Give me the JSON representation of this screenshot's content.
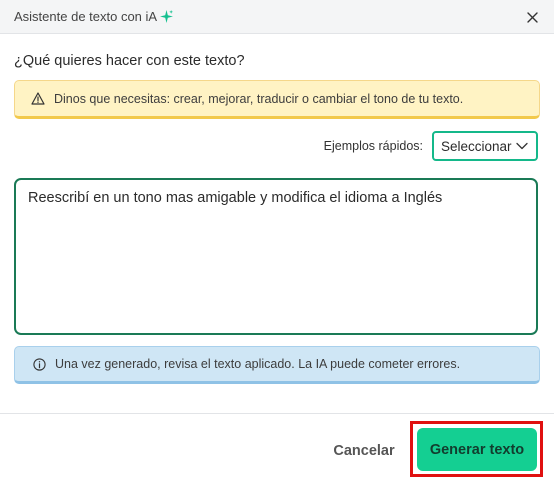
{
  "header": {
    "title": "Asistente de texto con iA",
    "accent_color": "#14c08f"
  },
  "question": "¿Qué quieres hacer con este texto?",
  "warning": {
    "text": "Dinos que necesitas: crear, mejorar, traducir o cambiar el tono de tu texto.",
    "color": "#f2c94c"
  },
  "quick_examples": {
    "label": "Ejemplos rápidos:",
    "selected": "Seleccionar"
  },
  "prompt": {
    "value": "Reescribí en un tono mas amigable y modifica el idioma a Inglés"
  },
  "info": {
    "text": "Una vez generado, revisa el texto aplicado. La IA puede cometer errores.",
    "color": "#8fc2e6"
  },
  "footer": {
    "cancel_label": "Cancelar",
    "generate_label": "Generar texto",
    "generate_color": "#14cf92",
    "highlight_color": "#e01010"
  }
}
